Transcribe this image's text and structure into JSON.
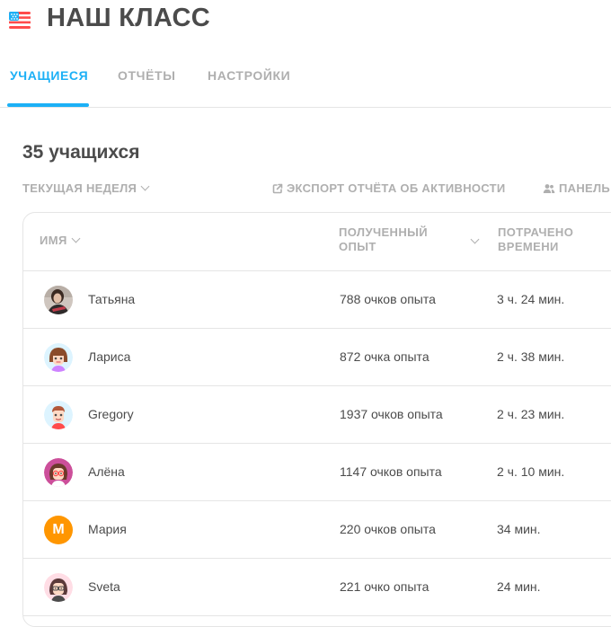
{
  "header": {
    "title": "НАШ КЛАСС",
    "flag_icon": "us-flag-icon"
  },
  "tabs": [
    {
      "label": "УЧАЩИЕСЯ",
      "active": true
    },
    {
      "label": "ОТЧЁТЫ",
      "active": false
    },
    {
      "label": "НАСТРОЙКИ",
      "active": false
    }
  ],
  "students_count": "35 учащихся",
  "toolbar": {
    "week_filter": "ТЕКУЩАЯ НЕДЕЛЯ",
    "export_label": "ЭКСПОРТ ОТЧЁТА ОБ АКТИВНОСТИ",
    "panel_label": "ПАНЕЛЬ"
  },
  "table": {
    "columns": {
      "name": "ИМЯ",
      "xp_line1": "ПОЛУЧЕННЫЙ",
      "xp_line2": "ОПЫТ",
      "time_line1": "ПОТРАЧЕНО",
      "time_line2": "ВРЕМЕНИ"
    },
    "rows": [
      {
        "name": "Татьяна",
        "xp": "788 очков опыта",
        "time": "3 ч. 24 мин.",
        "avatar": "photo"
      },
      {
        "name": "Лариса",
        "xp": "872 очка опыта",
        "time": "2 ч. 38 мин.",
        "avatar": "girl-bangs"
      },
      {
        "name": "Gregory",
        "xp": "1937 очков опыта",
        "time": "2 ч. 23 мин.",
        "avatar": "boy"
      },
      {
        "name": "Алёна",
        "xp": "1147 очков опыта",
        "time": "2 ч. 10 мин.",
        "avatar": "girl-glasses"
      },
      {
        "name": "Мария",
        "xp": "220 очков опыта",
        "time": "34 мин.",
        "avatar": "letter",
        "initial": "M"
      },
      {
        "name": "Sveta",
        "xp": "221 очко опыта",
        "time": "24 мин.",
        "avatar": "woman-glasses"
      }
    ]
  },
  "colors": {
    "accent": "#1cb0f6",
    "muted": "#afafaf",
    "text": "#4b4b4b",
    "border": "#e5e5e5",
    "orange": "#ff9600"
  }
}
